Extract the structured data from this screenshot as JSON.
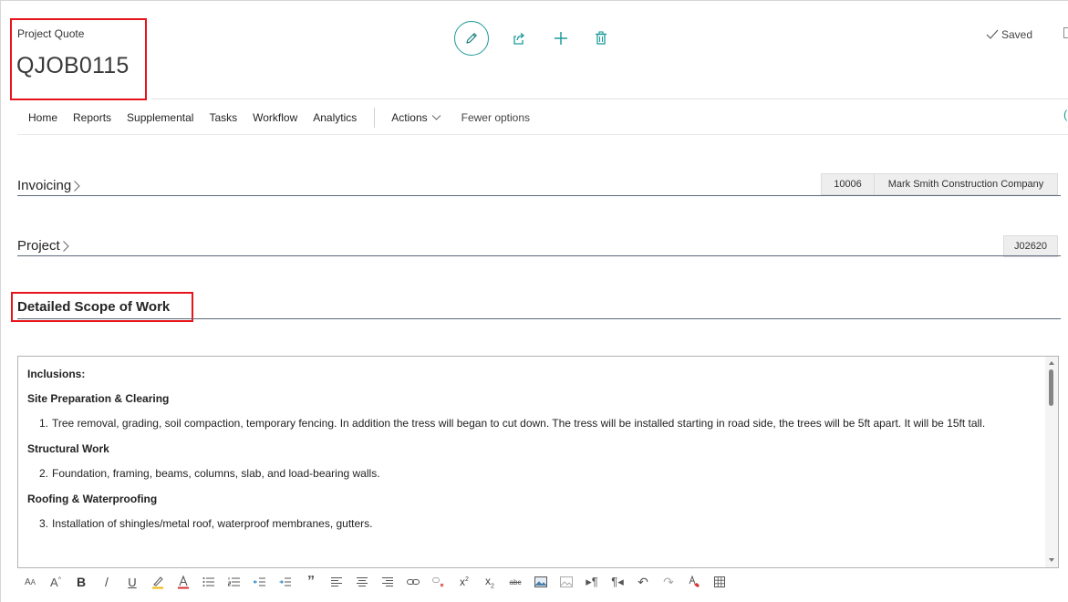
{
  "header": {
    "caption": "Project Quote",
    "title": "QJOB0115",
    "saved_label": "Saved"
  },
  "nav": {
    "items": [
      "Home",
      "Reports",
      "Supplemental",
      "Tasks",
      "Workflow",
      "Analytics"
    ],
    "actions_label": "Actions",
    "fewer_label": "Fewer options"
  },
  "fasttabs": {
    "invoicing": {
      "label": "Invoicing",
      "customer_no": "10006",
      "customer_name": "Mark Smith Construction Company"
    },
    "project": {
      "label": "Project",
      "project_no": "J02620"
    }
  },
  "scope": {
    "label": "Detailed Scope of Work",
    "inclusions_heading": "Inclusions:",
    "sections": [
      {
        "heading": "Site Preparation & Clearing",
        "num": "1.",
        "text": "Tree removal, grading, soil compaction, temporary fencing. In addition the tress will began to cut down. The tress will be installed starting in road side, the trees will be 5ft apart. It will be 15ft tall."
      },
      {
        "heading": "Structural Work",
        "num": "2.",
        "text": "Foundation, framing, beams, columns, slab, and load-bearing walls."
      },
      {
        "heading": "Roofing & Waterproofing",
        "num": "3.",
        "text": "Installation of shingles/metal roof, waterproof membranes, gutters."
      }
    ]
  },
  "colors": {
    "accent": "#1f9a9a",
    "highlight": "#e8141b",
    "highlighter_yellow": "#f2b705",
    "font_color_red": "#d63030"
  },
  "icons": [
    "edit-icon",
    "share-icon",
    "add-icon",
    "delete-icon",
    "checkmark-icon",
    "chevron-down-icon",
    "chevron-right-icon"
  ],
  "format_toolbar": {
    "tools": [
      {
        "name": "font-size-icon",
        "glyph": "Aᴀ"
      },
      {
        "name": "grow-font-icon",
        "glyph": "A"
      },
      {
        "name": "bold-icon",
        "glyph": "B"
      },
      {
        "name": "italic-icon",
        "glyph": "/"
      },
      {
        "name": "underline-icon",
        "glyph": "U"
      },
      {
        "name": "highlight-icon",
        "glyph": ""
      },
      {
        "name": "font-color-icon",
        "glyph": "A"
      },
      {
        "name": "bullet-list-icon",
        "glyph": ""
      },
      {
        "name": "numbered-list-icon",
        "glyph": ""
      },
      {
        "name": "decrease-indent-icon",
        "glyph": ""
      },
      {
        "name": "increase-indent-icon",
        "glyph": ""
      },
      {
        "name": "quote-icon",
        "glyph": "”"
      },
      {
        "name": "align-left-icon",
        "glyph": ""
      },
      {
        "name": "align-center-icon",
        "glyph": ""
      },
      {
        "name": "align-right-icon",
        "glyph": ""
      },
      {
        "name": "link-icon",
        "glyph": ""
      },
      {
        "name": "unlink-icon",
        "glyph": ""
      },
      {
        "name": "superscript-icon",
        "glyph": "x²"
      },
      {
        "name": "subscript-icon",
        "glyph": "x₂"
      },
      {
        "name": "strikethrough-icon",
        "glyph": "abc"
      },
      {
        "name": "insert-image-icon",
        "glyph": ""
      },
      {
        "name": "image-alt-icon",
        "glyph": ""
      },
      {
        "name": "ltr-icon",
        "glyph": "¶"
      },
      {
        "name": "rtl-icon",
        "glyph": "¶"
      },
      {
        "name": "undo-icon",
        "glyph": "↶"
      },
      {
        "name": "redo-icon",
        "glyph": "↷"
      },
      {
        "name": "clear-format-icon",
        "glyph": ""
      },
      {
        "name": "table-icon",
        "glyph": ""
      }
    ]
  }
}
